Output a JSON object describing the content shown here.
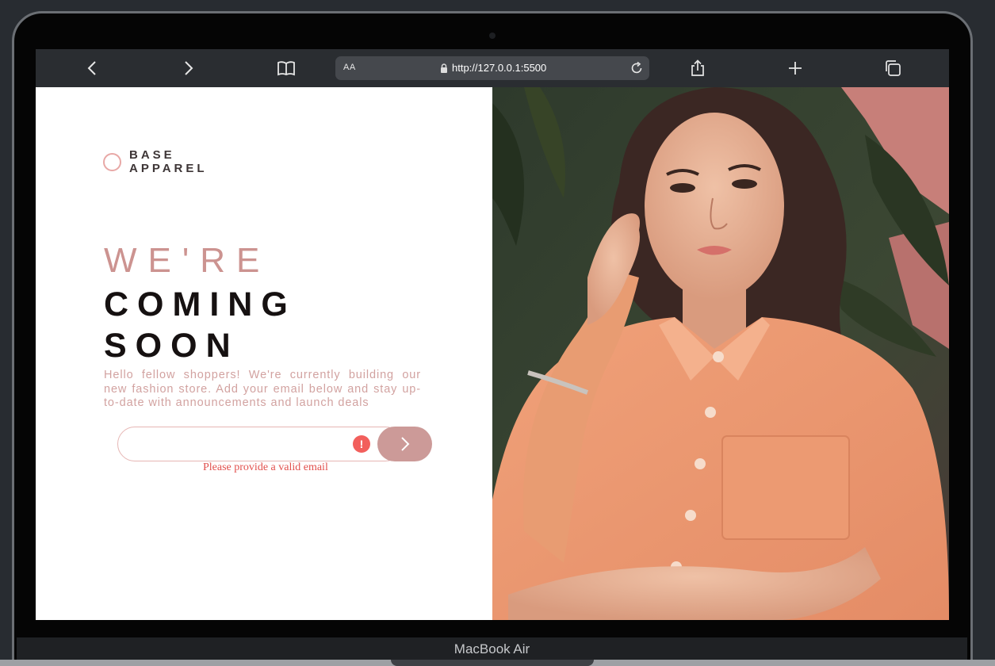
{
  "browser": {
    "reader_label": "AA",
    "url": "http://127.0.0.1:5500"
  },
  "brand": {
    "line1": "BASE",
    "line2": "APPAREL"
  },
  "heading": {
    "light": "WE'RE",
    "line2": "COMING",
    "line3": "SOON"
  },
  "description": "Hello fellow shoppers! We're currently building our new fashion store. Add your email below and stay up-to-date with announcements and launch deals",
  "form": {
    "email_value": "",
    "error_icon": "!",
    "error_message": "Please provide a valid email"
  },
  "device": {
    "label": "MacBook Air"
  },
  "colors": {
    "accent": "#cc9a98",
    "error": "#f25f5c",
    "dark_text": "#161111"
  }
}
